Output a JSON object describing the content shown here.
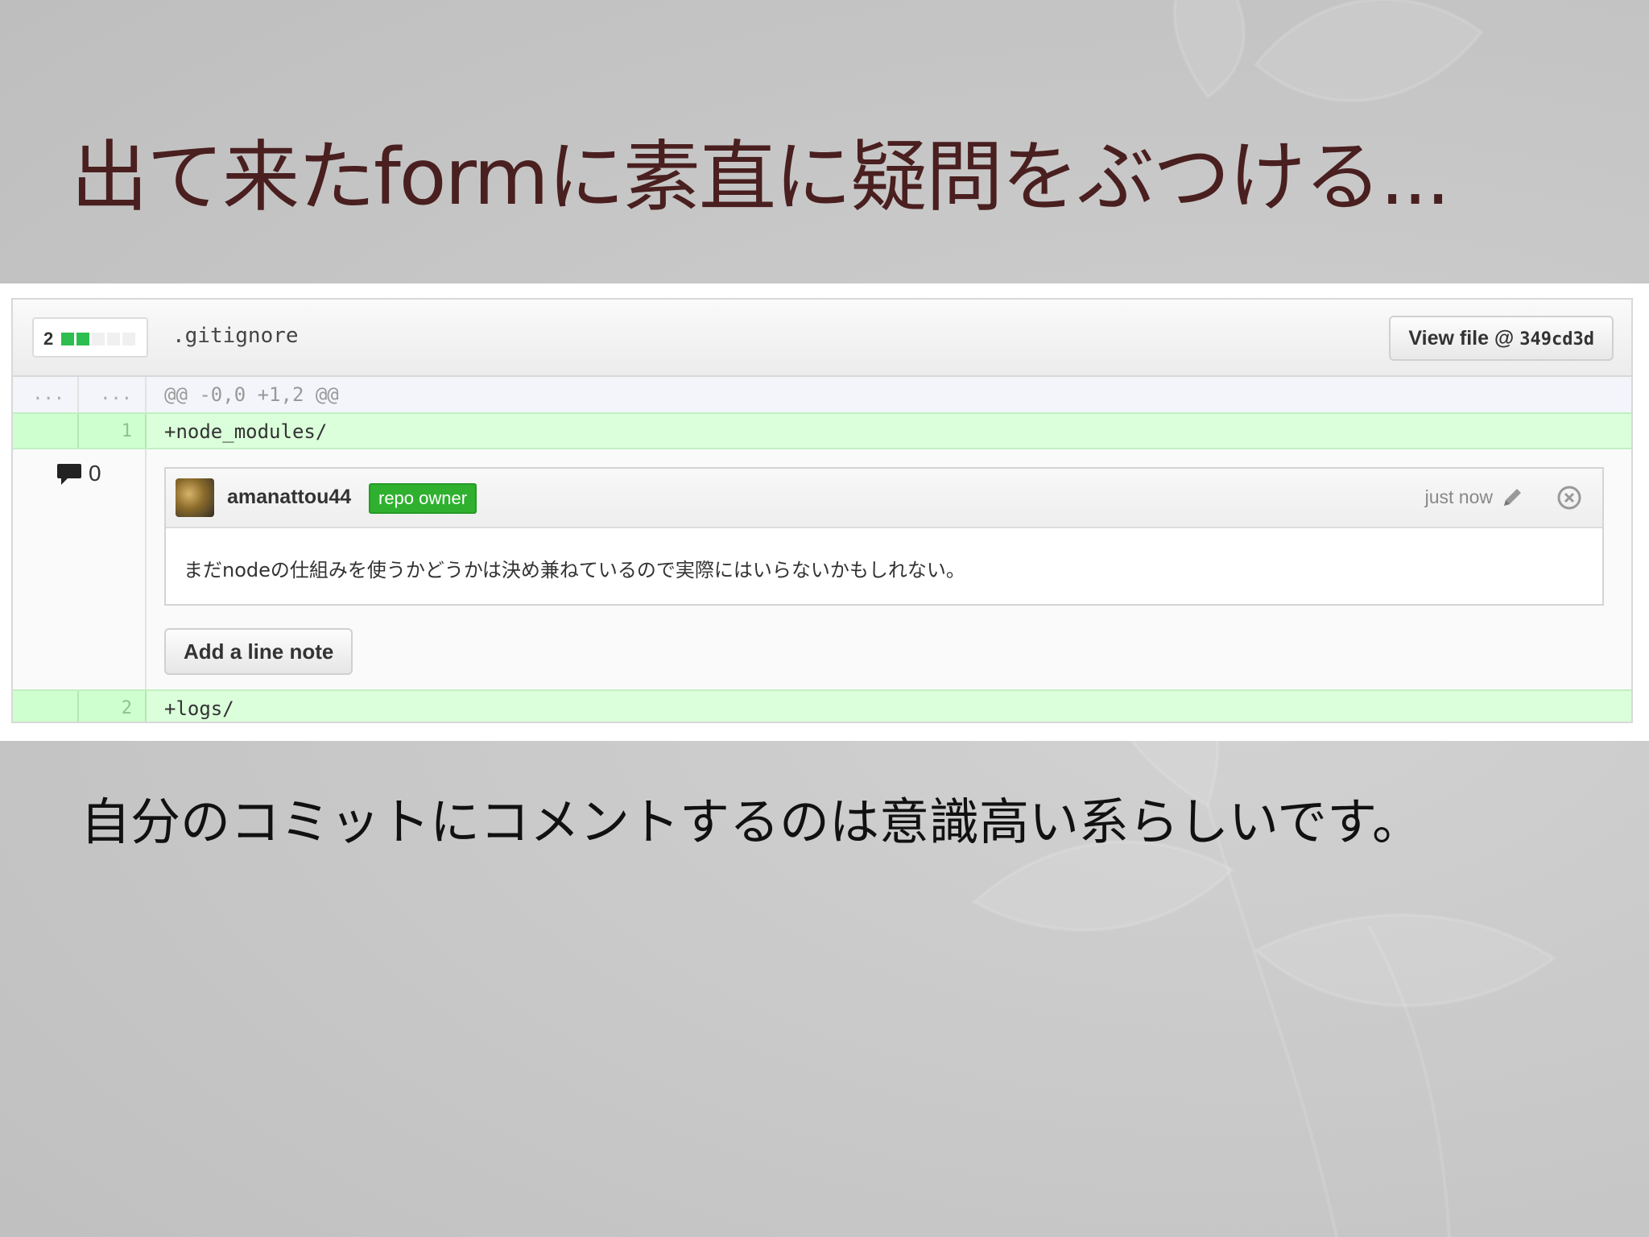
{
  "slide": {
    "title": "出て来たformに素直に疑問をぶつける...",
    "caption": "自分のコミットにコメントするのは意識高い系らしいです。"
  },
  "diff": {
    "file": {
      "stat_count": "2",
      "stat_added_blocks": 2,
      "stat_total_blocks": 5,
      "name": ".gitignore",
      "view_file_label": "View file @",
      "commit_sha": "349cd3d"
    },
    "hunk": {
      "old_num": "...",
      "new_num": "...",
      "header": "@@ -0,0 +1,2 @@"
    },
    "lines": [
      {
        "new_num": "1",
        "code": "+node_modules/"
      },
      {
        "new_num": "2",
        "code": "+logs/"
      }
    ],
    "comment_count": "0",
    "comment": {
      "author": "amanattou44",
      "badge": "repo owner",
      "time": "just now",
      "body": "まだnodeの仕組みを使うかどうかは決め兼ねているので実際にはいらないかもしれない。"
    },
    "add_note_label": "Add a line note"
  },
  "colors": {
    "title_text": "#4a1f1f",
    "added_line_bg": "#dbffdb",
    "added_stat": "#2cbe4e",
    "badge_green": "#2fb12f"
  },
  "icons": [
    "comment-bubble-icon",
    "pencil-icon",
    "close-circle-icon"
  ]
}
